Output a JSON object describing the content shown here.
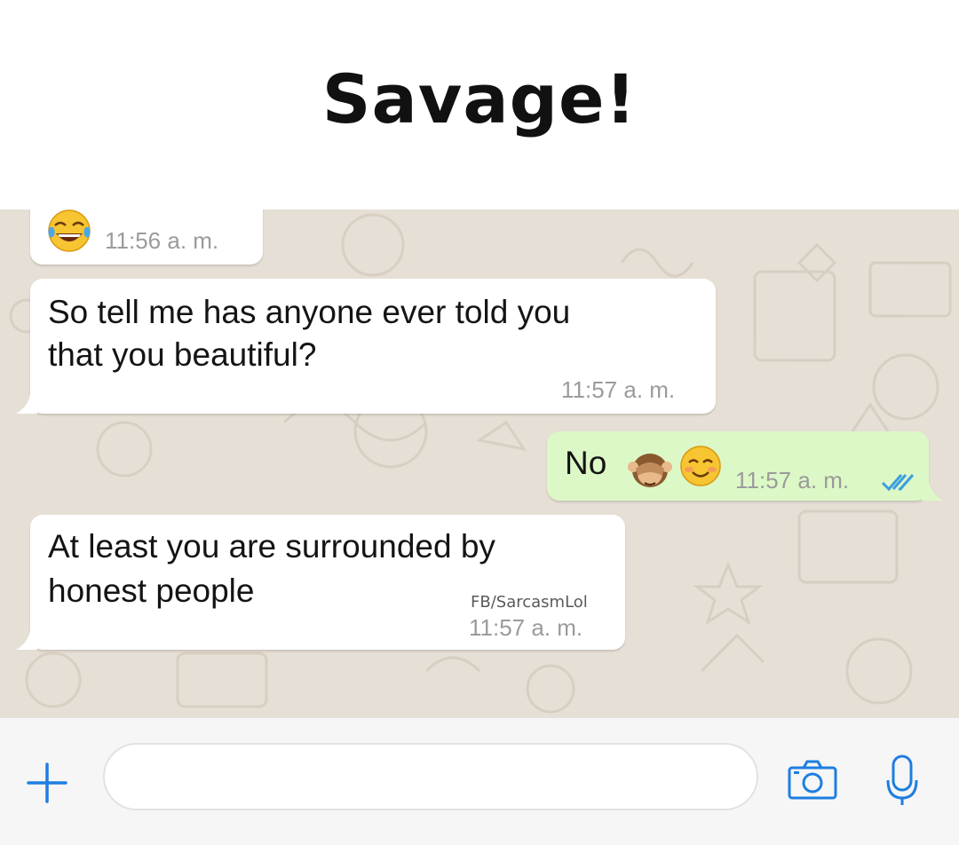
{
  "header": {
    "title": "Savage!"
  },
  "messages": [
    {
      "direction": "incoming",
      "emoji": "tears-of-joy",
      "time": "11:56 a. m."
    },
    {
      "direction": "incoming",
      "lines": [
        "So tell me has anyone ever told you",
        "that you beautiful?"
      ],
      "time": "11:57 a. m."
    },
    {
      "direction": "outgoing",
      "text": "No",
      "emojis": [
        "see-no-evil-monkey",
        "smiling-blushing-face"
      ],
      "time": "11:57 a. m.",
      "status": "read-double-check"
    },
    {
      "direction": "incoming",
      "lines": [
        "At least you are surrounded by",
        "honest people"
      ],
      "watermark": "FB/SarcasmLol",
      "time": "11:57 a. m."
    }
  ],
  "input_bar": {
    "attach_icon": "plus-icon",
    "message_placeholder": "",
    "camera_icon": "camera-icon",
    "mic_icon": "microphone-icon"
  },
  "colors": {
    "incoming_bubble": "#ffffff",
    "outgoing_bubble": "#dcf8c6",
    "wallpaper": "#e6dfd5",
    "accent_blue": "#1e7ee0",
    "read_ticks": "#3c9ee0"
  }
}
